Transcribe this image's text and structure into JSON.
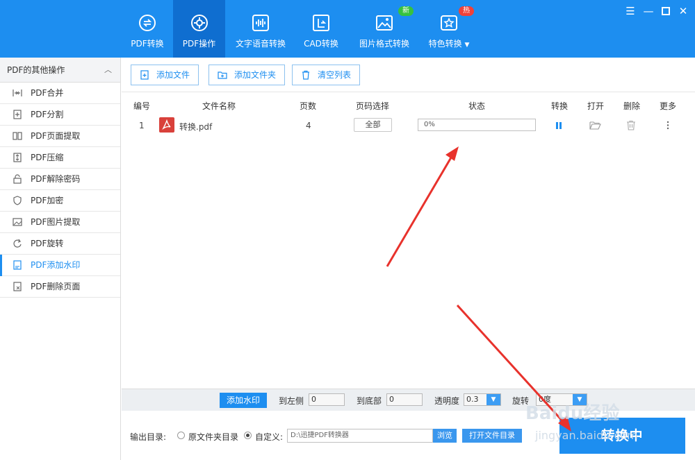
{
  "nav": {
    "items": [
      {
        "label": "PDF转换",
        "icon": "convert-icon"
      },
      {
        "label": "PDF操作",
        "icon": "gear-icon"
      },
      {
        "label": "文字语音转换",
        "icon": "audio-wave-icon"
      },
      {
        "label": "CAD转换",
        "icon": "cad-icon"
      },
      {
        "label": "图片格式转换",
        "icon": "image-icon"
      },
      {
        "label": "特色转换",
        "icon": "star-icon"
      }
    ],
    "badge_new": "新",
    "badge_hot": "热",
    "dropdown_icon": "caret-down-icon"
  },
  "window": {
    "menu_icon": "menu-icon",
    "minimize_icon": "minimize-icon",
    "maximize_icon": "maximize-icon",
    "close_icon": "close-icon"
  },
  "sidebar": {
    "header": "PDF的其他操作",
    "items": [
      {
        "label": "PDF合并",
        "icon": "merge-icon"
      },
      {
        "label": "PDF分割",
        "icon": "split-icon"
      },
      {
        "label": "PDF页面提取",
        "icon": "page-extract-icon"
      },
      {
        "label": "PDF压缩",
        "icon": "compress-icon"
      },
      {
        "label": "PDF解除密码",
        "icon": "unlock-icon"
      },
      {
        "label": "PDF加密",
        "icon": "shield-icon"
      },
      {
        "label": "PDF图片提取",
        "icon": "image-extract-icon"
      },
      {
        "label": "PDF旋转",
        "icon": "rotate-icon"
      },
      {
        "label": "PDF添加水印",
        "icon": "watermark-icon"
      },
      {
        "label": "PDF删除页面",
        "icon": "delete-page-icon"
      }
    ]
  },
  "toolbar": {
    "add_file": "添加文件",
    "add_folder": "添加文件夹",
    "clear_list": "清空列表"
  },
  "table": {
    "headers": [
      "编号",
      "文件名称",
      "页数",
      "页码选择",
      "状态",
      "转换",
      "打开",
      "删除",
      "更多"
    ],
    "rows": [
      {
        "index": "1",
        "name": "转换.pdf",
        "pages": "4",
        "page_select": "全部",
        "status": "0%"
      }
    ]
  },
  "options": {
    "add_watermark": "添加水印",
    "left_label": "到左侧",
    "left_value": "0",
    "bottom_label": "到底部",
    "bottom_value": "0",
    "opacity_label": "透明度",
    "opacity_value": "0.3",
    "rotate_label": "旋转",
    "rotate_value": "0度"
  },
  "output": {
    "label": "输出目录:",
    "opt_original": "原文件夹目录",
    "opt_custom": "自定义:",
    "path": "D:\\迅捷PDF转换器",
    "browse": "浏览",
    "open_folder": "打开文件目录",
    "convert": "转换中"
  },
  "watermark_text": {
    "line1": "Baidu经验",
    "line2": "jingyan.baidu.com"
  },
  "colors": {
    "primary": "#1d8ef0",
    "annotation_arrow": "#e8322c"
  }
}
